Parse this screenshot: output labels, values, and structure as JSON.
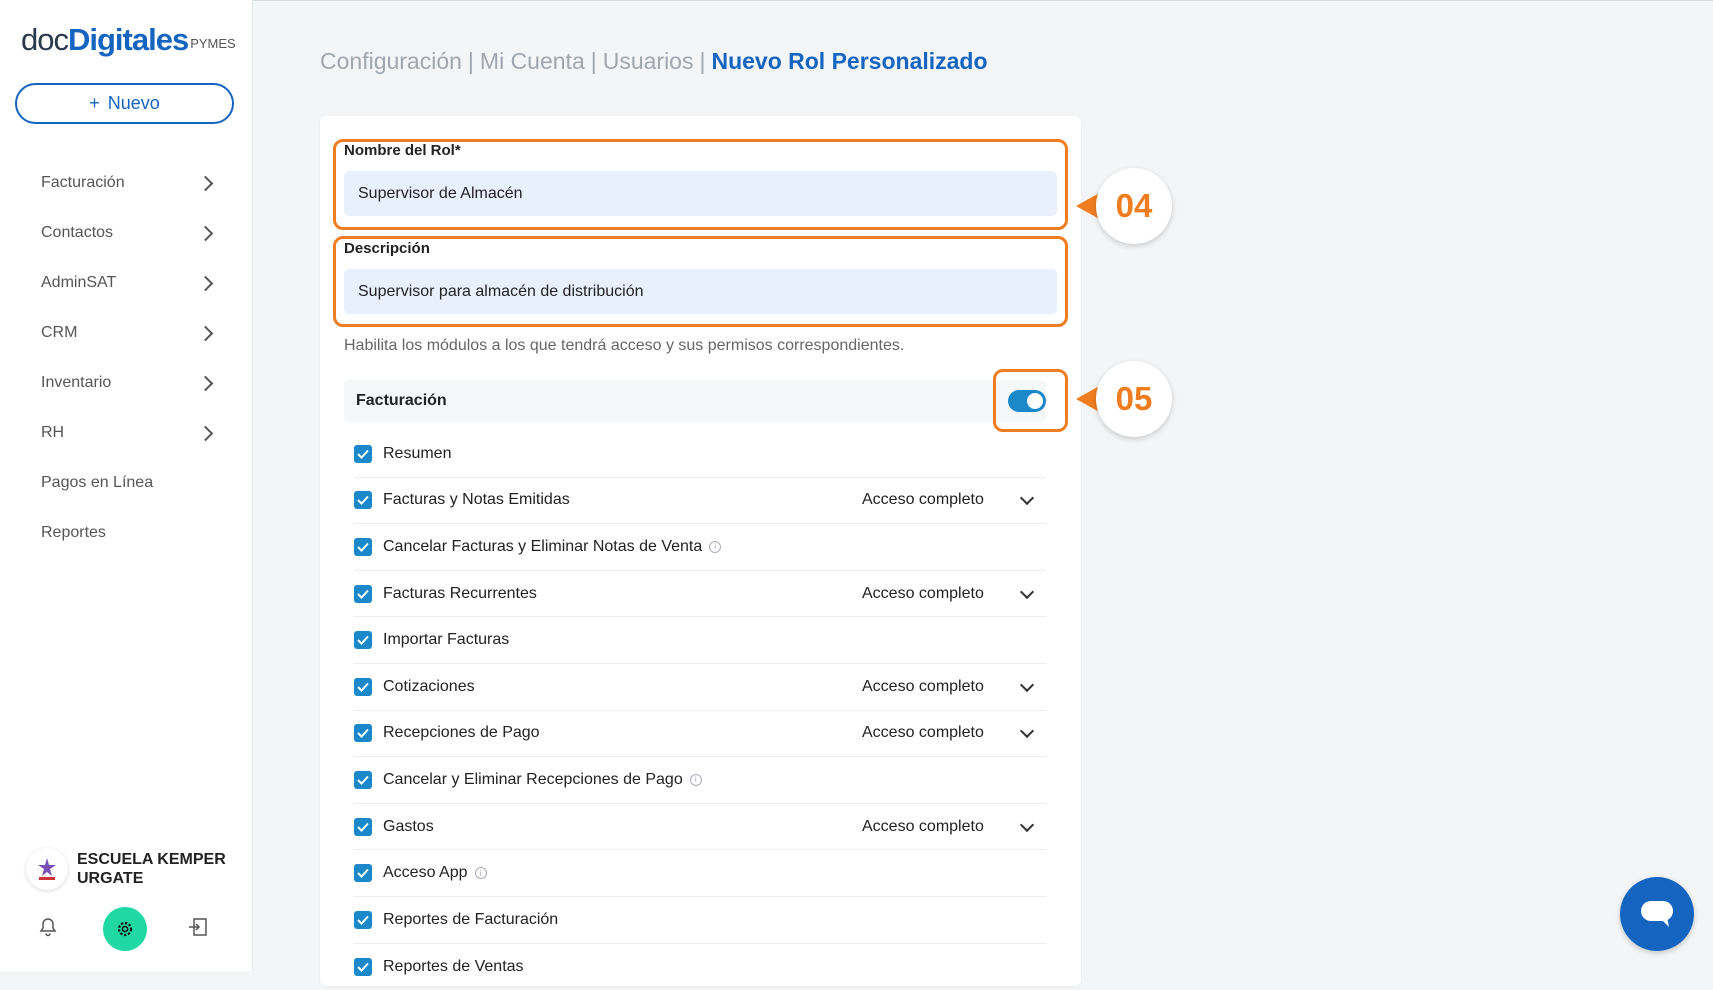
{
  "sidebar": {
    "logo": {
      "doc": "doc",
      "digitales": "Digitales",
      "pymes": "PYMES"
    },
    "new_button": "Nuevo",
    "items": [
      {
        "label": "Facturación",
        "has_chevron": true
      },
      {
        "label": "Contactos",
        "has_chevron": true
      },
      {
        "label": "AdminSAT",
        "has_chevron": true
      },
      {
        "label": "CRM",
        "has_chevron": true
      },
      {
        "label": "Inventario",
        "has_chevron": true
      },
      {
        "label": "RH",
        "has_chevron": true
      },
      {
        "label": "Pagos en Línea",
        "has_chevron": false
      },
      {
        "label": "Reportes",
        "has_chevron": false
      }
    ],
    "account_name": "ESCUELA KEMPER URGATE",
    "icons": [
      "bell-icon",
      "gear-icon",
      "logout-icon"
    ]
  },
  "breadcrumb": {
    "items": [
      "Configuración",
      "Mi Cuenta",
      "Usuarios"
    ],
    "separator": "|",
    "current": "Nuevo Rol Personalizado"
  },
  "form": {
    "role_name_label": "Nombre del Rol*",
    "role_name_value": "Supervisor de Almacén",
    "description_label": "Descripción",
    "description_value": "Supervisor para almacén de distribución",
    "hint": "Habilita los módulos a los que tendrá acceso y sus permisos correspondientes."
  },
  "module": {
    "title": "Facturación",
    "enabled": true,
    "permissions": [
      {
        "label": "Resumen",
        "checked": true,
        "access": "",
        "info": false
      },
      {
        "label": "Facturas y Notas Emitidas",
        "checked": true,
        "access": "Acceso completo",
        "info": false
      },
      {
        "label": "Cancelar Facturas y Eliminar Notas de Venta",
        "checked": true,
        "access": "",
        "info": true
      },
      {
        "label": "Facturas Recurrentes",
        "checked": true,
        "access": "Acceso completo",
        "info": false
      },
      {
        "label": "Importar Facturas",
        "checked": true,
        "access": "",
        "info": false
      },
      {
        "label": "Cotizaciones",
        "checked": true,
        "access": "Acceso completo",
        "info": false
      },
      {
        "label": "Recepciones de Pago",
        "checked": true,
        "access": "Acceso completo",
        "info": false
      },
      {
        "label": "Cancelar y Eliminar Recepciones de Pago",
        "checked": true,
        "access": "",
        "info": true
      },
      {
        "label": "Gastos",
        "checked": true,
        "access": "Acceso completo",
        "info": false
      },
      {
        "label": "Acceso App",
        "checked": true,
        "access": "",
        "info": true
      },
      {
        "label": "Reportes de Facturación",
        "checked": true,
        "access": "",
        "info": false
      },
      {
        "label": "Reportes de Ventas",
        "checked": true,
        "access": "",
        "info": false
      }
    ]
  },
  "callouts": [
    "04",
    "05"
  ],
  "colors": {
    "primary": "#1565c0",
    "accent": "#f07d1f",
    "toggle": "#1a88c9",
    "gear": "#1fd8a4"
  }
}
